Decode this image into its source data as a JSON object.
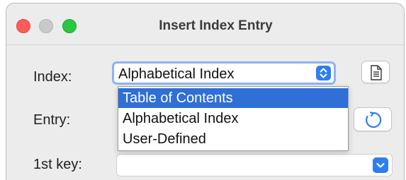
{
  "window": {
    "title": "Insert Index Entry"
  },
  "form": {
    "index_label": "Index:",
    "entry_label": "Entry:",
    "first_key_label": "1st key:",
    "index_value": "Alphabetical Index",
    "first_key_value": "",
    "entry_value": ""
  },
  "dropdown": {
    "options": [
      {
        "label": "Table of Contents",
        "selected": true
      },
      {
        "label": "Alphabetical Index",
        "selected": false
      },
      {
        "label": "User-Defined",
        "selected": false
      }
    ]
  },
  "icons": {
    "index_button": "document-icon",
    "entry_button": "refresh-icon",
    "popup_arrow": "chevron-updown-icon",
    "combo_arrow": "chevron-down-icon"
  },
  "colors": {
    "accent": "#2e7ef1",
    "selection": "#2f6fd6",
    "close": "#fd5c59",
    "zoom": "#28c840"
  }
}
